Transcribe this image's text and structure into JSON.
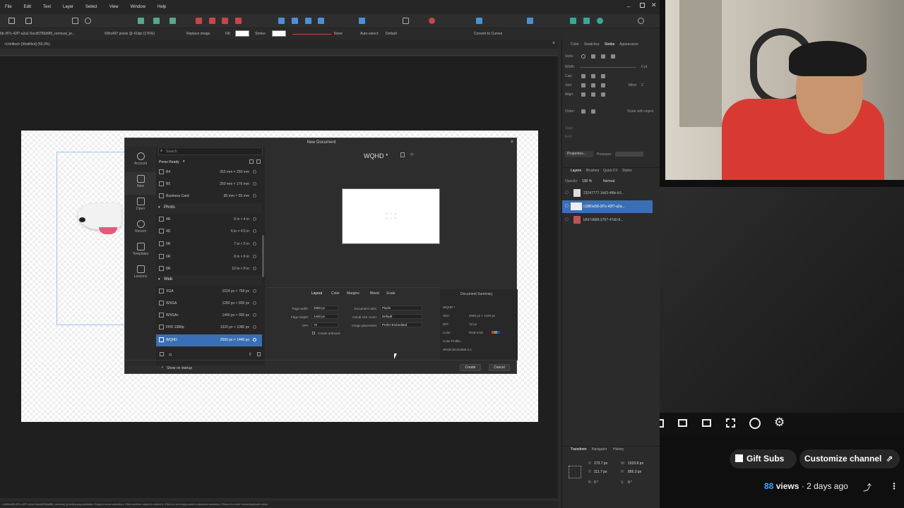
{
  "menu": [
    "File",
    "Edit",
    "Text",
    "Layer",
    "Select",
    "View",
    "Window",
    "Help"
  ],
  "context_toolbar": {
    "file_name": "6b-3f7c-42f7-a2a1-5acd5786d9f5_removal_pr...",
    "image_info": "600x497 pixels @ 41dpi (176%)",
    "replace_image": "Replace image",
    "fill_label": "Fill:",
    "stroke_label": "Stroke:",
    "stroke_value": "None",
    "auto_select_label": "Auto-select:",
    "auto_select_value": "Default",
    "convert_to_curves": "Convert to Curves"
  },
  "document_tab": "<Untitled> [Modified] (55.3%)",
  "right_panel": {
    "top_tabs": [
      "Color",
      "Swatches",
      "Stroke",
      "Appearance"
    ],
    "style_label": "Style:",
    "width_label": "Width:",
    "width_value": "0 pt",
    "cap_label": "Cap:",
    "join_label": "Join:",
    "mitre_label": "Mitre:",
    "mitre_value": "2",
    "align_label": "Align:",
    "order_label": "Order:",
    "scale_with_object": "Scale with object",
    "start_label": "Start:",
    "end_label": "End:",
    "properties_button": "Properties...",
    "pressure_label": "Pressure:",
    "layers_tabs": [
      "Layers",
      "Brushes",
      "Quick FX",
      "Styles"
    ],
    "opacity_label": "Opacity:",
    "opacity_value": "100 %",
    "blend_mode": "Normal",
    "layers": [
      {
        "name": "23247777-1b63-4f8e-b3...",
        "selected": false
      },
      {
        "name": "c1881e58-3f7c-42f7-a2a...",
        "selected": true
      },
      {
        "name": "b507d888-3757-47d0-8...",
        "selected": false
      }
    ],
    "transform_tabs": [
      "Transform",
      "Navigator",
      "History"
    ],
    "transform": {
      "x_label": "X:",
      "x": "173.7 px",
      "y_label": "Y:",
      "y": "111.7 px",
      "w_label": "W:",
      "w": "1033.8 px",
      "h_label": "H:",
      "h": "856.3 px",
      "r_label": "R:",
      "r": "0 °",
      "s_label": "S:",
      "s": "0 °"
    }
  },
  "dialog": {
    "title": "New Document",
    "nav": [
      "Account",
      "New",
      "Open",
      "Recent",
      "Templates",
      "Lessons"
    ],
    "search_placeholder": "Search",
    "filter": "Press Ready",
    "presets_top": [
      {
        "name": "B4",
        "dims": "353 mm × 250 mm"
      },
      {
        "name": "B5",
        "dims": "250 mm × 176 mm"
      },
      {
        "name": "Business Card",
        "dims": "85 mm × 55 mm"
      }
    ],
    "photo_header": "Photo",
    "photo_presets": [
      {
        "name": "4R",
        "dims": "6 in × 4 in"
      },
      {
        "name": "4D",
        "dims": "6 in × 4.5 in"
      },
      {
        "name": "5R",
        "dims": "7 in × 5 in"
      },
      {
        "name": "6R",
        "dims": "8 in × 6 in"
      },
      {
        "name": "8R",
        "dims": "10 in × 8 in"
      }
    ],
    "web_header": "Web",
    "web_presets": [
      {
        "name": "XGA",
        "dims": "1024 px × 768 px",
        "selected": false
      },
      {
        "name": "WXGA",
        "dims": "1280 px × 800 px",
        "selected": false
      },
      {
        "name": "WXGA+",
        "dims": "1440 px × 900 px",
        "selected": false
      },
      {
        "name": "FHD 1080p",
        "dims": "1920 px × 1080 px",
        "selected": false
      },
      {
        "name": "WQHD",
        "dims": "2560 px × 1440 px",
        "selected": true
      }
    ],
    "preview_title": "WQHD *",
    "option_tabs": [
      "Layout",
      "Color",
      "Margins",
      "Bleed",
      "Scale"
    ],
    "fields": {
      "page_width_label": "Page width:",
      "page_width": "2560 px",
      "page_height_label": "Page height:",
      "page_height": "1440 px",
      "dpi_label": "DPI:",
      "dpi": "72",
      "create_artboard": "Create artboard",
      "document_units_label": "Document units:",
      "document_units": "Pixels",
      "actual_size_zoom_label": "Actual size zoom:",
      "actual_size_zoom": "Default",
      "image_placement_label": "Image placement:",
      "image_placement": "Prefer Embedded"
    },
    "summary": {
      "title": "Document Summary",
      "name": "WQHD *",
      "size_label": "Size:",
      "size": "2560 px × 1440 px",
      "dpi_label": "DPI:",
      "dpi": "72 px",
      "color_label": "Color:",
      "color": "RGB 8-bit",
      "profile_label": "Color Profile:",
      "profile": "sRGB IEC61966-2.1"
    },
    "show_on_startup": "Show on startup",
    "create": "Create",
    "cancel": "Cancel"
  },
  "status_bar": "c1881e58-3f7c-42f7-a2a1-5acd5786d9f5_removal_preview.png selected. Drag to move selection. Click another object to select it. Click on an empty area to deselect selection. Return to enter move/duplicate value",
  "youtube": {
    "gift_subs": "Gift Subs",
    "customize": "Customize channel",
    "views_count": "88",
    "views_label": "views",
    "date": "2 days ago"
  }
}
